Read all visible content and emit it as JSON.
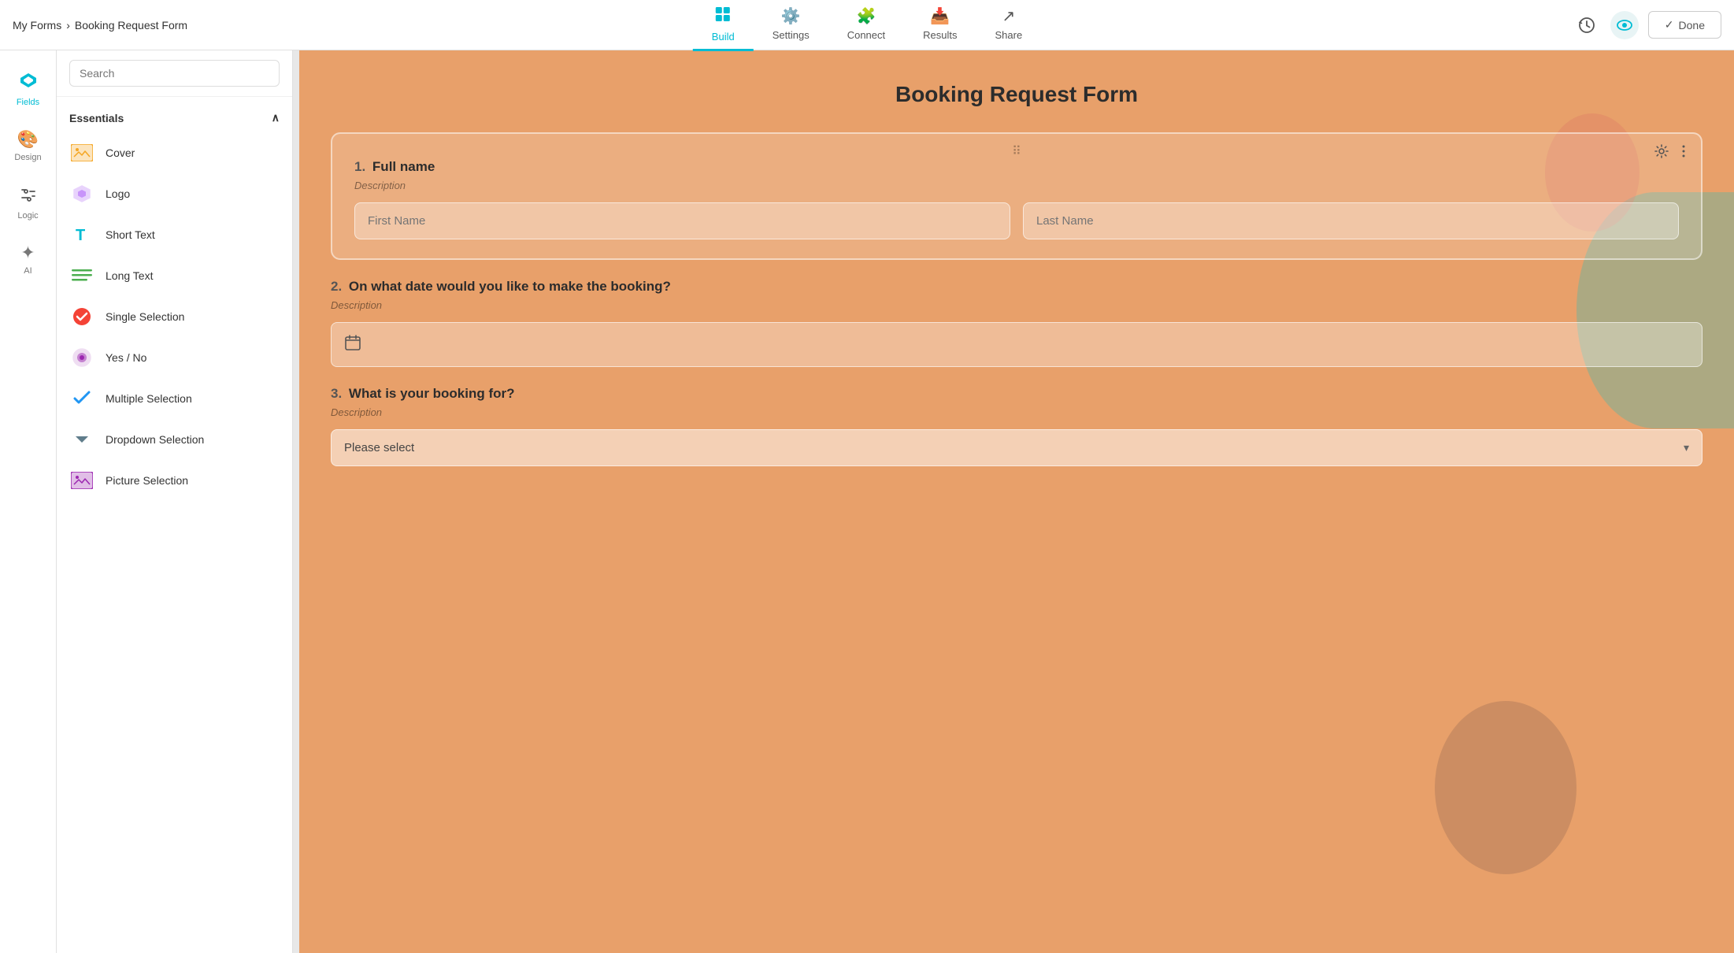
{
  "breadcrumb": {
    "parent": "My Forms",
    "separator": "›",
    "current": "Booking Request Form"
  },
  "nav_tabs": [
    {
      "id": "build",
      "label": "Build",
      "icon": "🗂",
      "active": true
    },
    {
      "id": "settings",
      "label": "Settings",
      "icon": "⚙️",
      "active": false
    },
    {
      "id": "connect",
      "label": "Connect",
      "icon": "🧩",
      "active": false
    },
    {
      "id": "results",
      "label": "Results",
      "icon": "📥",
      "active": false
    },
    {
      "id": "share",
      "label": "Share",
      "icon": "↗",
      "active": false
    }
  ],
  "nav_right": {
    "history_label": "⟳",
    "preview_label": "👁",
    "done_label": "Done"
  },
  "sidebar_icons": [
    {
      "id": "fields",
      "label": "Fields",
      "icon": "◈",
      "active": true
    },
    {
      "id": "design",
      "label": "Design",
      "icon": "🎨",
      "active": false
    },
    {
      "id": "logic",
      "label": "Logic",
      "icon": "✕",
      "active": false
    },
    {
      "id": "ai",
      "label": "AI",
      "icon": "✦",
      "active": false
    }
  ],
  "search_placeholder": "Search",
  "sections": [
    {
      "id": "essentials",
      "label": "Essentials",
      "expanded": true,
      "fields": [
        {
          "id": "cover",
          "label": "Cover",
          "icon": "cover"
        },
        {
          "id": "logo",
          "label": "Logo",
          "icon": "logo"
        },
        {
          "id": "short-text",
          "label": "Short Text",
          "icon": "short-text"
        },
        {
          "id": "long-text",
          "label": "Long Text",
          "icon": "long-text"
        },
        {
          "id": "single-selection",
          "label": "Single Selection",
          "icon": "single"
        },
        {
          "id": "yes-no",
          "label": "Yes / No",
          "icon": "yesno"
        },
        {
          "id": "multiple-selection",
          "label": "Multiple Selection",
          "icon": "multi"
        },
        {
          "id": "dropdown-selection",
          "label": "Dropdown Selection",
          "icon": "dropdown"
        },
        {
          "id": "picture-selection",
          "label": "Picture Selection",
          "icon": "picture"
        }
      ]
    }
  ],
  "form": {
    "title": "Booking Request Form",
    "questions": [
      {
        "num": "1.",
        "label": "Full name",
        "description": "Description",
        "type": "name",
        "fields": [
          {
            "placeholder": "First Name"
          },
          {
            "placeholder": "Last Name"
          }
        ]
      },
      {
        "num": "2.",
        "label": "On what date would you like to make the booking?",
        "description": "Description",
        "type": "date"
      },
      {
        "num": "3.",
        "label": "What is your booking for?",
        "description": "Description",
        "type": "dropdown",
        "placeholder": "Please select"
      }
    ]
  }
}
